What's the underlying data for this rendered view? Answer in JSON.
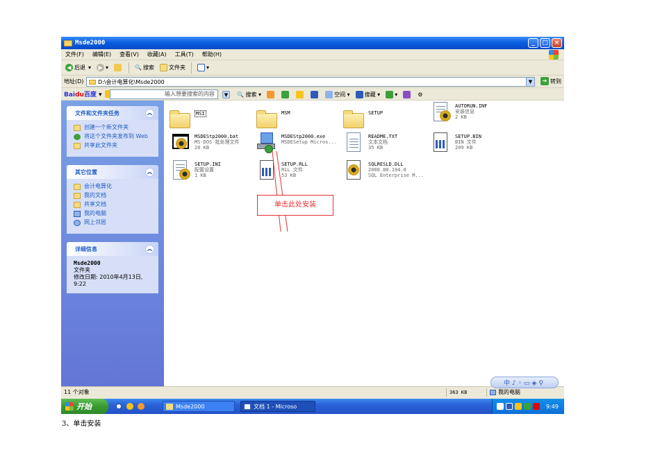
{
  "window": {
    "title": "Msde2000",
    "buttons": {
      "minimize": "_",
      "maximize": "□",
      "close": "×"
    }
  },
  "menu": [
    "文件(F)",
    "编辑(E)",
    "查看(V)",
    "收藏(A)",
    "工具(T)",
    "帮助(H)"
  ],
  "toolbar": {
    "back": "后退",
    "search": "搜索",
    "folders": "文件夹"
  },
  "address": {
    "label": "地址(D)",
    "value": "D:\\会计电算化\\Msde2000",
    "go": "转到"
  },
  "baidu": {
    "placeholder": "输入想要搜索的内容",
    "search": "搜索",
    "space": "空间",
    "favorites": "搜藏"
  },
  "left_panel": {
    "tasks": {
      "title": "文件和文件夹任务",
      "items": [
        "创建一个新文件夹",
        "将这个文件夹发布到 Web",
        "共享此文件夹"
      ]
    },
    "places": {
      "title": "其它位置",
      "items": [
        "会计电算化",
        "我的文档",
        "共享文档",
        "我的电脑",
        "网上邻居"
      ]
    },
    "details": {
      "title": "详细信息",
      "name": "Msde2000",
      "type": "文件夹",
      "modified": "修改日期: 2010年4月13日, 9:22"
    }
  },
  "files": [
    {
      "name": "MSI",
      "type": "",
      "size": "",
      "icon": "folder-icon"
    },
    {
      "name": "MSM",
      "type": "",
      "size": "",
      "icon": "folder-icon"
    },
    {
      "name": "SETUP",
      "type": "",
      "size": "",
      "icon": "folder-icon"
    },
    {
      "name": "AUTORUN.INF",
      "type": "安装信息",
      "size": "2 KB",
      "icon": "setup-info-icon"
    },
    {
      "name": "MSDEStp2000.bat",
      "type": "MS-DOS 批处理文件",
      "size": "20 KB",
      "icon": "batch-file-icon"
    },
    {
      "name": "MSDEStp2000.exe",
      "type": "MSDESetup Micros...",
      "size": "",
      "icon": "installer-icon"
    },
    {
      "name": "README.TXT",
      "type": "文本文档",
      "size": "35 KB",
      "icon": "text-document-icon"
    },
    {
      "name": "SETUP.BIN",
      "type": "BIN 文件",
      "size": "209 KB",
      "icon": "bin-file-icon"
    },
    {
      "name": "SETUP.INI",
      "type": "配置设置",
      "size": "1 KB",
      "icon": "config-file-icon"
    },
    {
      "name": "SETUP.RLL",
      "type": "RLL 文件",
      "size": "53 KB",
      "icon": "rll-file-icon"
    },
    {
      "name": "SQLRESLD.DLL",
      "type": "2000.80.194.0",
      "size": "SQL Enterprise M...",
      "icon": "dll-file-icon"
    }
  ],
  "annotation": "单击此处安装",
  "status": {
    "count": "11 个对象",
    "size": "363 KB",
    "location": "我的电脑"
  },
  "taskbar": {
    "start": "开始",
    "tasks": [
      "Msde2000",
      "文档 1 - Microso"
    ],
    "clock": "9:49"
  },
  "caption": "3、单击安装"
}
